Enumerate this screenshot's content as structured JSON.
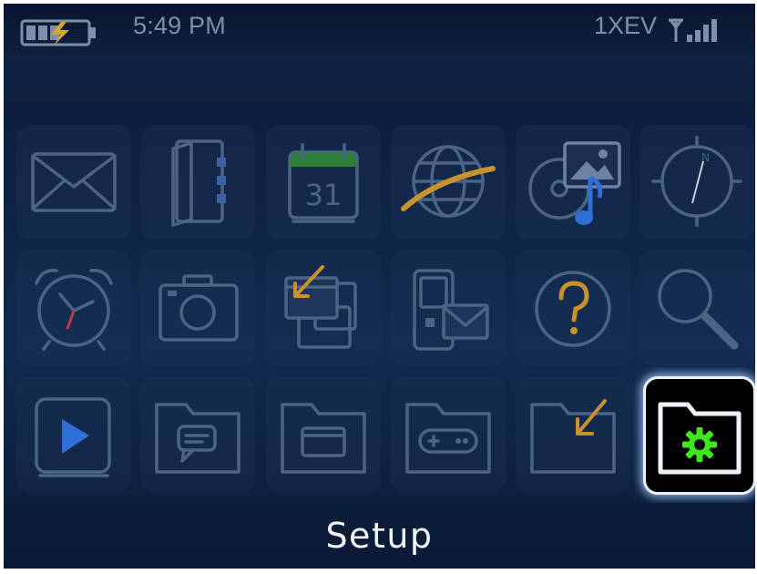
{
  "status": {
    "time": "5:49 PM",
    "network": "1XEV",
    "battery_icon": "battery-charging-icon",
    "signal_icon": "signal-bars-icon"
  },
  "apps": [
    {
      "icon": "envelope-icon"
    },
    {
      "icon": "address-book-icon"
    },
    {
      "icon": "calendar-icon",
      "calendar_day": "31"
    },
    {
      "icon": "globe-browser-icon"
    },
    {
      "icon": "media-icon"
    },
    {
      "icon": "compass-icon"
    },
    {
      "icon": "alarm-clock-icon"
    },
    {
      "icon": "camera-icon"
    },
    {
      "icon": "windows-switch-icon"
    },
    {
      "icon": "phone-message-icon"
    },
    {
      "icon": "question-mark-icon"
    },
    {
      "icon": "magnifier-icon"
    },
    {
      "icon": "play-icon"
    },
    {
      "icon": "folder-chat-icon"
    },
    {
      "icon": "folder-window-icon"
    },
    {
      "icon": "folder-gamepad-icon"
    },
    {
      "icon": "folder-download-icon"
    },
    {
      "icon": "folder-gear-icon",
      "selected": true
    }
  ],
  "selected_label": "Setup",
  "colors": {
    "selection_gear": "#3fe61c",
    "selection_border": "#eef2f8",
    "icon_stroke": "#4c6385"
  }
}
